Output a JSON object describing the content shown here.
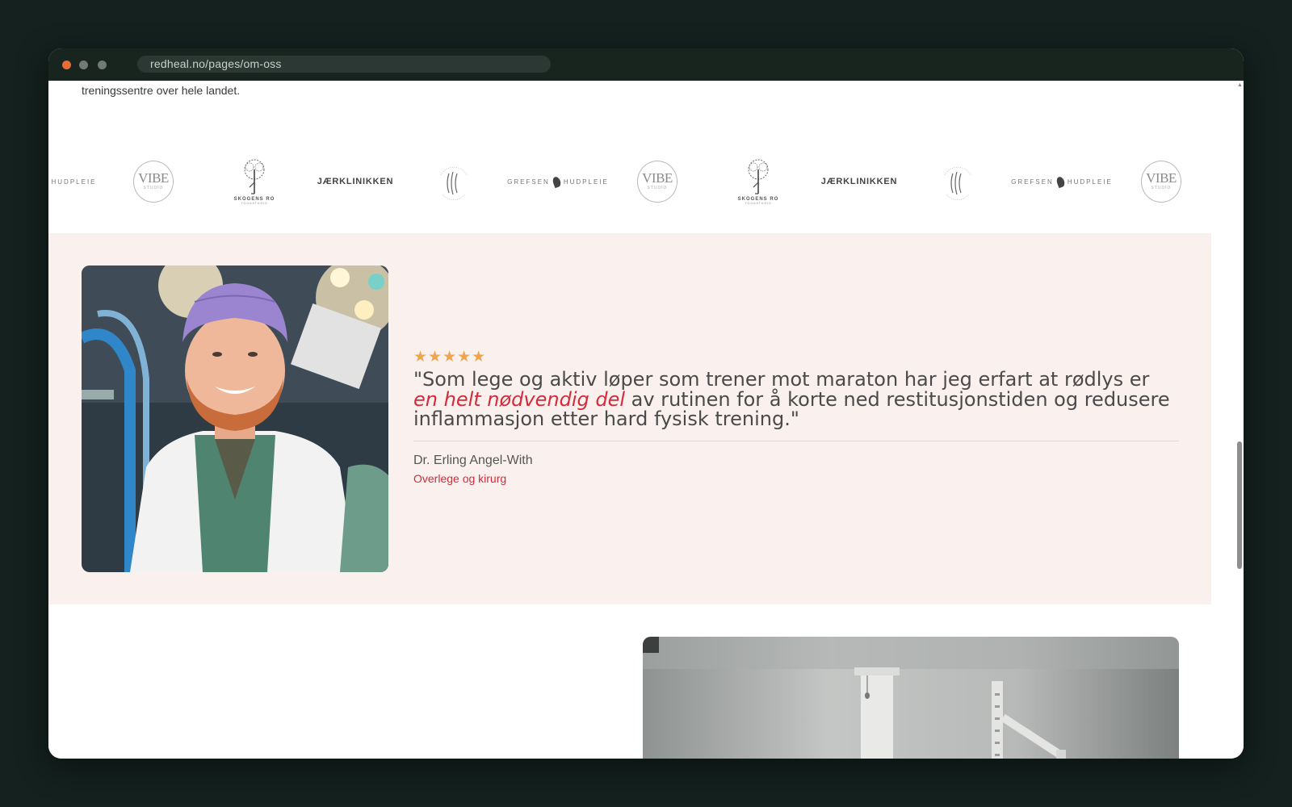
{
  "browser": {
    "url": "redheal.no/pages/om-oss"
  },
  "intro": {
    "text": "treningssentre over hele landet."
  },
  "logos": [
    {
      "name": "hudpleie-partial",
      "label": "HUDPLEIE"
    },
    {
      "name": "vibe-studio",
      "label": "VIBE",
      "sub": "STUDIO"
    },
    {
      "name": "skogens-ro",
      "label": "SKOGENS RO",
      "sub": "YOGASTUDIO"
    },
    {
      "name": "jaerklinikken",
      "label": "JÆRKLINIKKEN"
    },
    {
      "name": "benkterev-norge",
      "label": "BENKTEREV NORGE"
    },
    {
      "name": "grefsen-hudpleie",
      "label": "GREFSEN",
      "label2": "HUDPLEIE"
    },
    {
      "name": "vibe-studio",
      "label": "VIBE",
      "sub": "STUDIO"
    },
    {
      "name": "skogens-ro",
      "label": "SKOGENS RO",
      "sub": "YOGASTUDIO"
    },
    {
      "name": "jaerklinikken",
      "label": "JÆRKLINIKKEN"
    },
    {
      "name": "benkterev-norge",
      "label": "BENKTEREV NORGE"
    },
    {
      "name": "grefsen-hudpleie",
      "label": "GREFSEN",
      "label2": "HUDPLEIE"
    },
    {
      "name": "vibe-studio",
      "label": "VIBE",
      "sub": "STUDIO"
    }
  ],
  "testimonial": {
    "stars": "★★★★★",
    "rating": 5,
    "quote_before": "\"Som lege og aktiv løper som trener mot maraton har jeg erfart at rødlys er ",
    "quote_emphasis": "en helt nødvendig del",
    "quote_after": " av rutinen for å korte ned restitusjonstiden og redusere inflammasjon etter hard fysisk trening.\"",
    "author": "Dr. Erling Angel-With",
    "role": "Overlege og kirurg"
  },
  "colors": {
    "accent": "#d42a3b",
    "star": "#f0a54a",
    "testimonial_bg": "#faf1ee",
    "page_bg": "#14211e"
  }
}
